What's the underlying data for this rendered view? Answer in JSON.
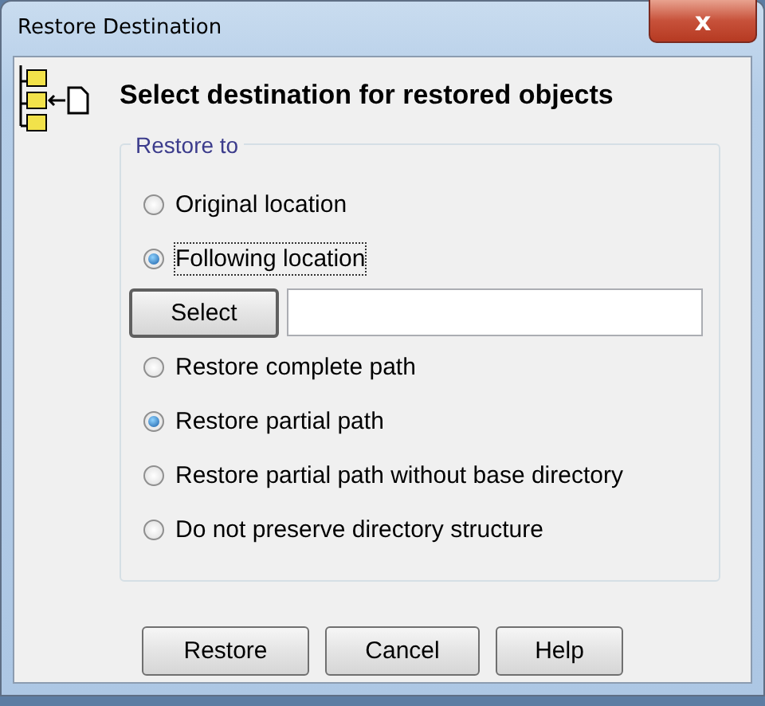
{
  "window": {
    "title": "Restore Destination",
    "close_label": "x"
  },
  "heading": "Select destination for restored objects",
  "group": {
    "legend": "Restore to",
    "location_options": [
      {
        "label": "Original location",
        "selected": false,
        "focused": false
      },
      {
        "label": "Following location",
        "selected": true,
        "focused": true
      }
    ],
    "select_button": "Select",
    "structure_options": [
      {
        "label": "Restore complete path",
        "selected": false
      },
      {
        "label": "Restore partial path",
        "selected": true
      },
      {
        "label": "Restore partial path without base directory",
        "selected": false
      },
      {
        "label": "Do not preserve directory structure",
        "selected": false
      }
    ]
  },
  "buttons": [
    "Restore",
    "Cancel",
    "Help"
  ]
}
